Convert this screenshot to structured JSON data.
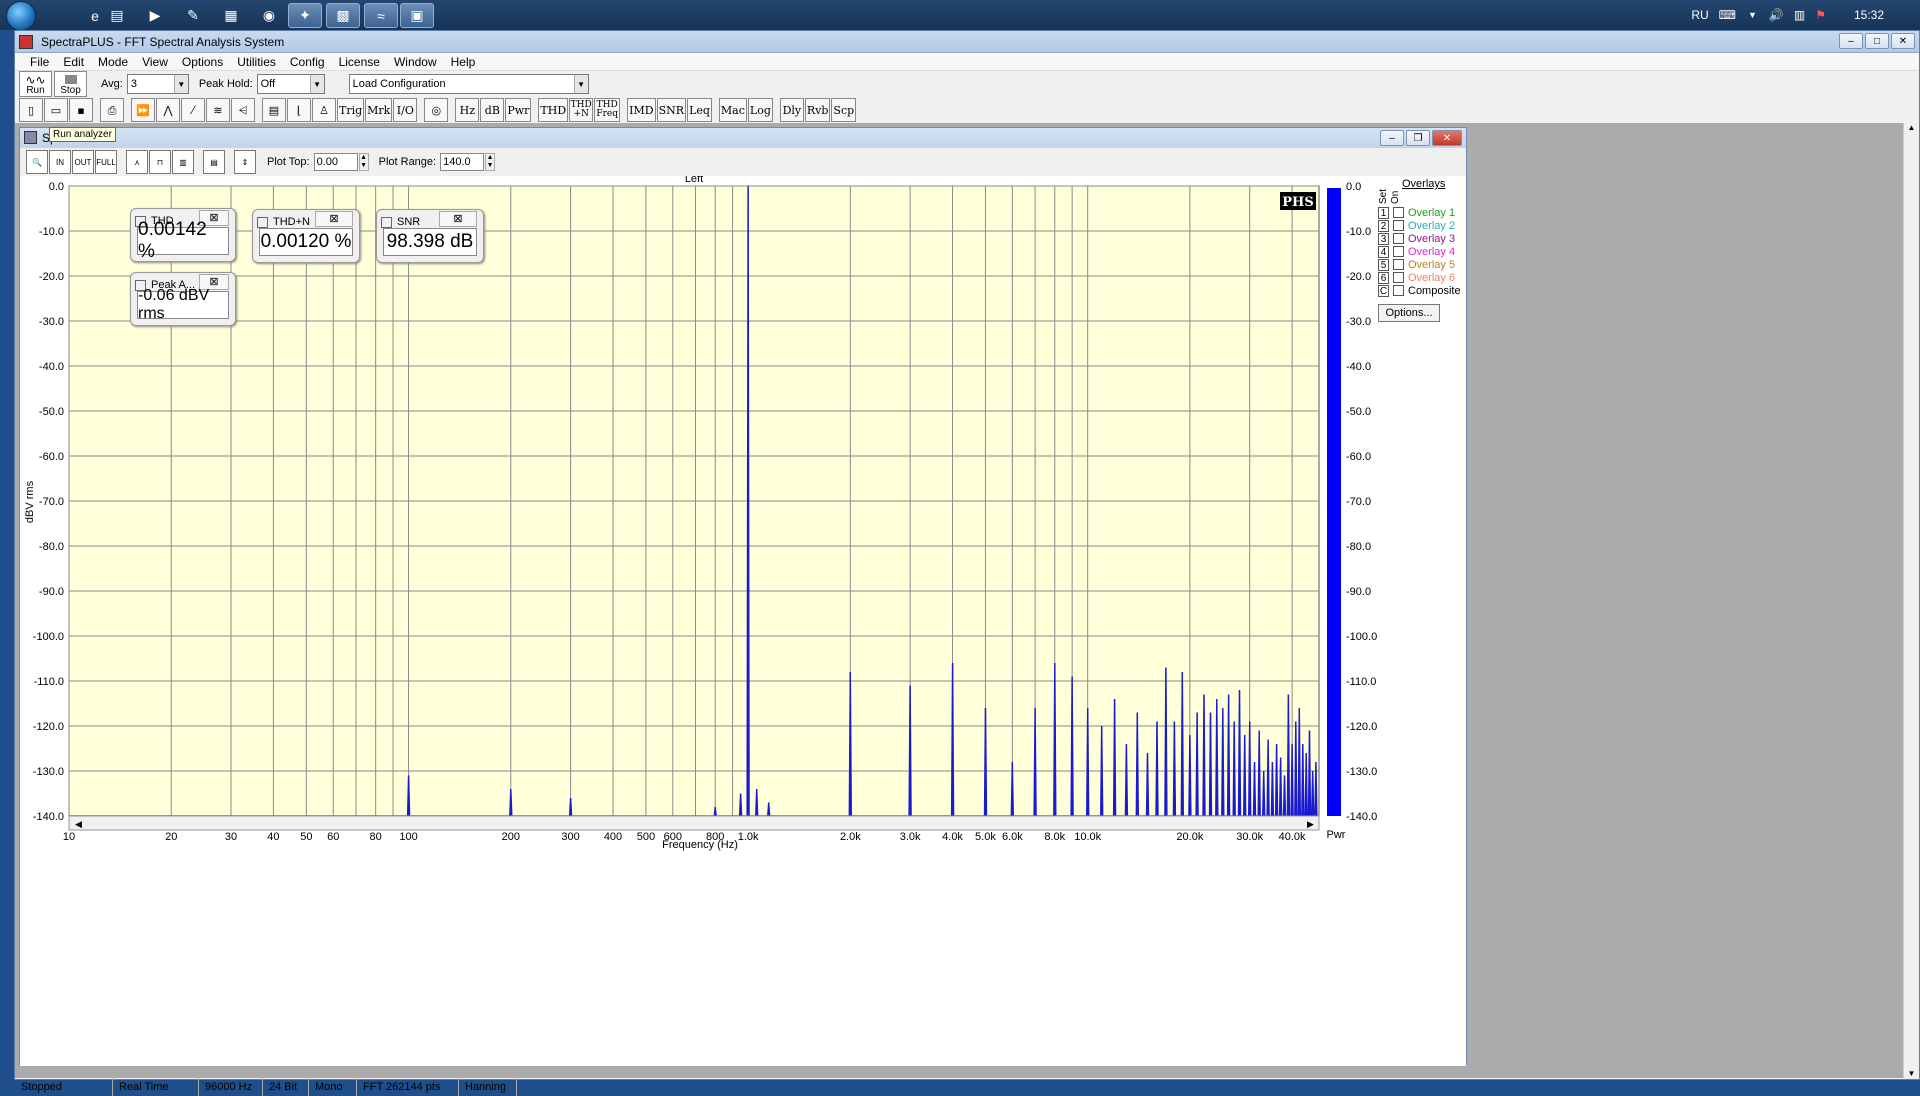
{
  "taskbar": {
    "language": "RU",
    "clock": "15:32"
  },
  "app": {
    "title": "SpectraPLUS - FFT Spectral Analysis System",
    "menu": [
      "File",
      "Edit",
      "Mode",
      "View",
      "Options",
      "Utilities",
      "Config",
      "License",
      "Window",
      "Help"
    ]
  },
  "toolbar1": {
    "run_label": "Run",
    "stop_label": "Stop",
    "avg_label": "Avg:",
    "avg_value": "3",
    "peak_hold_label": "Peak Hold:",
    "peak_hold_value": "Off",
    "config_value": "Load Configuration"
  },
  "toolbar2": {
    "tooltip": "Run analyzer",
    "buttons": [
      "Trig",
      "Mrk",
      "I/O",
      "Hz",
      "dB",
      "Pwr",
      "THD",
      "THD +N",
      "THD Freq",
      "IMD",
      "SNR",
      "Leq",
      "Mac",
      "Log",
      "Dly",
      "Rvb",
      "Scp"
    ]
  },
  "spectrum": {
    "title": "Spectrum",
    "plot_top_label": "Plot Top:",
    "plot_top_value": "0.00",
    "plot_range_label": "Plot Range:",
    "plot_range_value": "140.0",
    "channel_label": "Left",
    "brand": "PHS",
    "pwr_label": "Pwr"
  },
  "meters": {
    "thd": {
      "title": "THD",
      "value": "0.00142 %"
    },
    "thdn": {
      "title": "THD+N",
      "value": "0.00120 %"
    },
    "snr": {
      "title": "SNR",
      "value": "98.398 dB"
    },
    "peak": {
      "title": "Peak A...",
      "value": "-0.06 dBV rms"
    }
  },
  "overlays": {
    "title": "Overlays",
    "set_label": "Set",
    "on_label": "On",
    "items": [
      {
        "num": "1",
        "label": "Overlay 1",
        "color": "#1e9e1e"
      },
      {
        "num": "2",
        "label": "Overlay 2",
        "color": "#22b0b0"
      },
      {
        "num": "3",
        "label": "Overlay 3",
        "color": "#8a1a8a"
      },
      {
        "num": "4",
        "label": "Overlay 4",
        "color": "#e020e0"
      },
      {
        "num": "5",
        "label": "Overlay 5",
        "color": "#c08020"
      },
      {
        "num": "6",
        "label": "Overlay 6",
        "color": "#f08060"
      },
      {
        "num": "C",
        "label": "Composite",
        "color": "#000000"
      }
    ],
    "options_label": "Options..."
  },
  "status": {
    "state": "Stopped",
    "mode": "Real Time",
    "rate": "96000 Hz",
    "bits": "24 Bit",
    "channels": "Mono",
    "fft": "FFT 262144 pts",
    "window": "Hanning"
  },
  "chart_data": {
    "type": "line",
    "title": "Left",
    "xlabel": "Frequency (Hz)",
    "ylabel": "dBV rms",
    "x_scale": "log",
    "xlim": [
      10,
      48000
    ],
    "ylim": [
      -140,
      0
    ],
    "y_ticks": [
      "0.0",
      "-10.0",
      "-20.0",
      "-30.0",
      "-40.0",
      "-50.0",
      "-60.0",
      "-70.0",
      "-80.0",
      "-90.0",
      "-100.0",
      "-110.0",
      "-120.0",
      "-130.0",
      "-140.0"
    ],
    "x_ticks": [
      {
        "v": 10,
        "l": "10"
      },
      {
        "v": 20,
        "l": "20"
      },
      {
        "v": 30,
        "l": "30"
      },
      {
        "v": 40,
        "l": "40"
      },
      {
        "v": 50,
        "l": "50"
      },
      {
        "v": 60,
        "l": "60"
      },
      {
        "v": 80,
        "l": "80"
      },
      {
        "v": 100,
        "l": "100"
      },
      {
        "v": 200,
        "l": "200"
      },
      {
        "v": 300,
        "l": "300"
      },
      {
        "v": 400,
        "l": "400"
      },
      {
        "v": 500,
        "l": "500"
      },
      {
        "v": 600,
        "l": "600"
      },
      {
        "v": 800,
        "l": "800"
      },
      {
        "v": 1000,
        "l": "1.0k"
      },
      {
        "v": 2000,
        "l": "2.0k"
      },
      {
        "v": 3000,
        "l": "3.0k"
      },
      {
        "v": 4000,
        "l": "4.0k"
      },
      {
        "v": 5000,
        "l": "5.0k"
      },
      {
        "v": 6000,
        "l": "6.0k"
      },
      {
        "v": 8000,
        "l": "8.0k"
      },
      {
        "v": 10000,
        "l": "10.0k"
      },
      {
        "v": 20000,
        "l": "20.0k"
      },
      {
        "v": 30000,
        "l": "30.0k"
      },
      {
        "v": 40000,
        "l": "40.0k"
      }
    ],
    "series": [
      {
        "color": "#1a1ad0",
        "peaks": [
          {
            "f": 100,
            "db": -131
          },
          {
            "f": 200,
            "db": -134
          },
          {
            "f": 300,
            "db": -136
          },
          {
            "f": 800,
            "db": -138
          },
          {
            "f": 950,
            "db": -135
          },
          {
            "f": 1000,
            "db": -0.06
          },
          {
            "f": 1060,
            "db": -134
          },
          {
            "f": 1150,
            "db": -137
          },
          {
            "f": 2000,
            "db": -108
          },
          {
            "f": 3000,
            "db": -111
          },
          {
            "f": 4000,
            "db": -106
          },
          {
            "f": 5000,
            "db": -116
          },
          {
            "f": 6000,
            "db": -128
          },
          {
            "f": 7000,
            "db": -116
          },
          {
            "f": 8000,
            "db": -106
          },
          {
            "f": 9000,
            "db": -109
          },
          {
            "f": 10000,
            "db": -116
          },
          {
            "f": 11000,
            "db": -120
          },
          {
            "f": 12000,
            "db": -114
          },
          {
            "f": 13000,
            "db": -124
          },
          {
            "f": 14000,
            "db": -117
          },
          {
            "f": 15000,
            "db": -126
          },
          {
            "f": 16000,
            "db": -119
          },
          {
            "f": 17000,
            "db": -107
          },
          {
            "f": 18000,
            "db": -119
          },
          {
            "f": 19000,
            "db": -108
          },
          {
            "f": 20000,
            "db": -122
          },
          {
            "f": 21000,
            "db": -117
          },
          {
            "f": 22000,
            "db": -113
          },
          {
            "f": 23000,
            "db": -117
          },
          {
            "f": 24000,
            "db": -114
          },
          {
            "f": 25000,
            "db": -116
          },
          {
            "f": 26000,
            "db": -113
          },
          {
            "f": 27000,
            "db": -119
          },
          {
            "f": 28000,
            "db": -112
          },
          {
            "f": 29000,
            "db": -122
          },
          {
            "f": 30000,
            "db": -119
          },
          {
            "f": 31000,
            "db": -128
          },
          {
            "f": 32000,
            "db": -121
          },
          {
            "f": 33000,
            "db": -130
          },
          {
            "f": 34000,
            "db": -123
          },
          {
            "f": 35000,
            "db": -128
          },
          {
            "f": 36000,
            "db": -124
          },
          {
            "f": 37000,
            "db": -127
          },
          {
            "f": 38000,
            "db": -131
          },
          {
            "f": 39000,
            "db": -113
          },
          {
            "f": 40000,
            "db": -124
          },
          {
            "f": 41000,
            "db": -119
          },
          {
            "f": 42000,
            "db": -116
          },
          {
            "f": 43000,
            "db": -124
          },
          {
            "f": 44000,
            "db": -126
          },
          {
            "f": 45000,
            "db": -121
          },
          {
            "f": 46000,
            "db": -130
          },
          {
            "f": 47000,
            "db": -128
          }
        ]
      }
    ],
    "grid": true
  }
}
